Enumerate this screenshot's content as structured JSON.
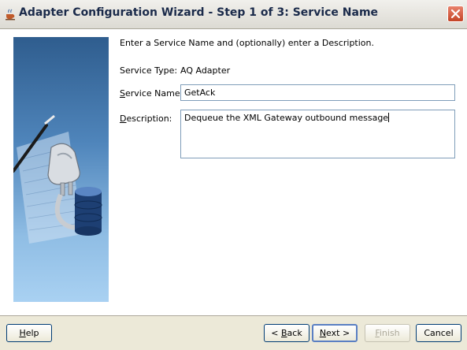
{
  "window": {
    "title": "Adapter Configuration Wizard - Step 1 of 3: Service Name"
  },
  "intro": "Enter a Service Name and (optionally) enter a Description.",
  "service_type": {
    "label": "Service Type:",
    "value": "AQ Adapter"
  },
  "service_name": {
    "label_mnemonic": "S",
    "label_rest": "ervice Name:",
    "value": "GetAck"
  },
  "description": {
    "label_mnemonic": "D",
    "label_rest": "escription:",
    "value": "Dequeue the XML Gateway outbound message"
  },
  "buttons": {
    "help": {
      "mnemonic": "H",
      "rest": "elp"
    },
    "back": {
      "prefix": "< ",
      "mnemonic": "B",
      "rest": "ack"
    },
    "next": {
      "mnemonic": "N",
      "rest": "ext >"
    },
    "finish": {
      "mnemonic": "F",
      "rest": "inish"
    },
    "cancel": "Cancel"
  },
  "icons": [
    "java-cup-icon",
    "close-icon",
    "adapter-plug-illustration"
  ]
}
